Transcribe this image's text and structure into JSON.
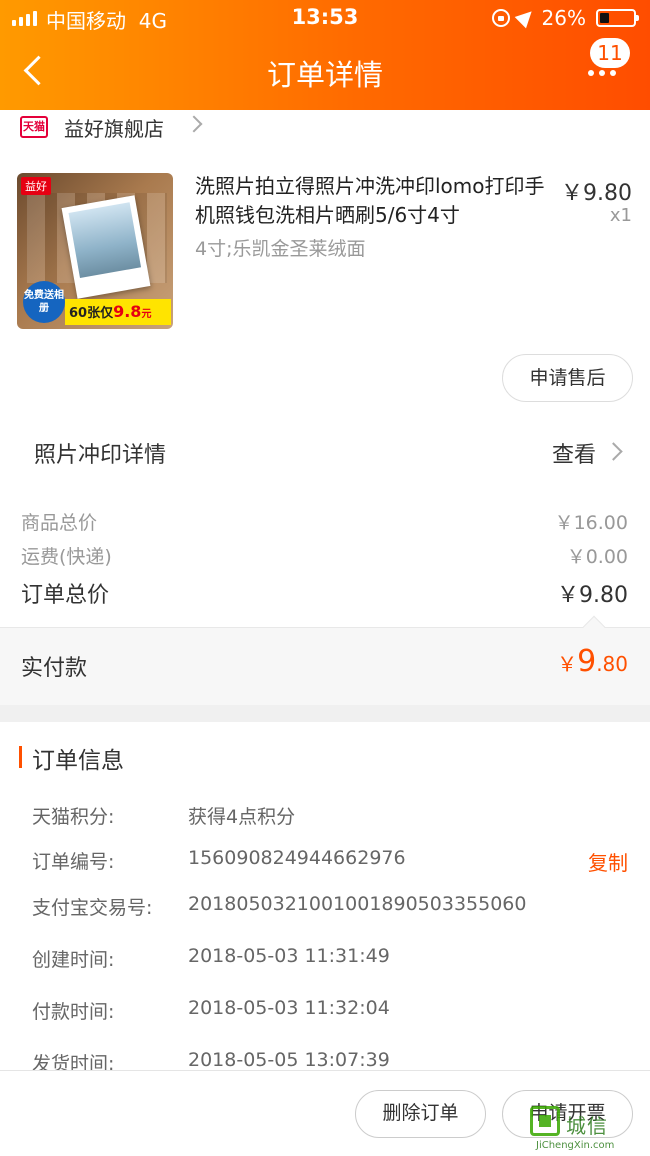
{
  "status_bar": {
    "carrier": "中国移动",
    "network": "4G",
    "time": "13:53",
    "battery": "26%"
  },
  "nav": {
    "title": "订单详情",
    "badge_count": "11"
  },
  "store": {
    "platform_tag": "天猫",
    "name": "益好旗舰店"
  },
  "product": {
    "thumb_brand": "益好",
    "thumb_badge": "免费送相册",
    "thumb_banner_prefix": "60张仅",
    "thumb_banner_price": "9.8",
    "thumb_banner_unit": "元",
    "title": "洗照片拍立得照片冲洗冲印lomo打印手机照钱包洗相片晒刷5/6寸4寸",
    "sku": "4寸;乐凯金圣莱绒面",
    "price": "￥9.80",
    "quantity": "x1",
    "aftersale_label": "申请售后"
  },
  "print_details": {
    "label": "照片冲印详情",
    "action": "查看"
  },
  "summary": {
    "goods_total_label": "商品总价",
    "goods_total_value": "￥16.00",
    "shipping_label": "运费(快递)",
    "shipping_value": "￥0.00",
    "order_total_label": "订单总价",
    "order_total_value": "￥9.80",
    "paid_label": "实付款",
    "paid_currency": "￥",
    "paid_int": "9",
    "paid_dec": ".80"
  },
  "order_info": {
    "title": "订单信息",
    "rows": [
      {
        "label": "天猫积分:",
        "value": "获得4点积分"
      },
      {
        "label": "订单编号:",
        "value": "156090824944662976"
      },
      {
        "label": "支付宝交易号:",
        "value": "2018050321001001890503355060"
      },
      {
        "label": "创建时间:",
        "value": "2018-05-03 11:31:49"
      },
      {
        "label": "付款时间:",
        "value": "2018-05-03 11:32:04"
      },
      {
        "label": "发货时间:",
        "value": "2018-05-05 13:07:39"
      }
    ],
    "copy_label": "复制"
  },
  "bottom": {
    "delete_label": "删除订单",
    "invoice_label": "申请开票"
  },
  "watermark": {
    "text": "城信",
    "url": "JiChengXin.com"
  },
  "colors": {
    "accent": "#ff5000",
    "header_start": "#ff9a00",
    "header_end": "#ff4d00"
  }
}
